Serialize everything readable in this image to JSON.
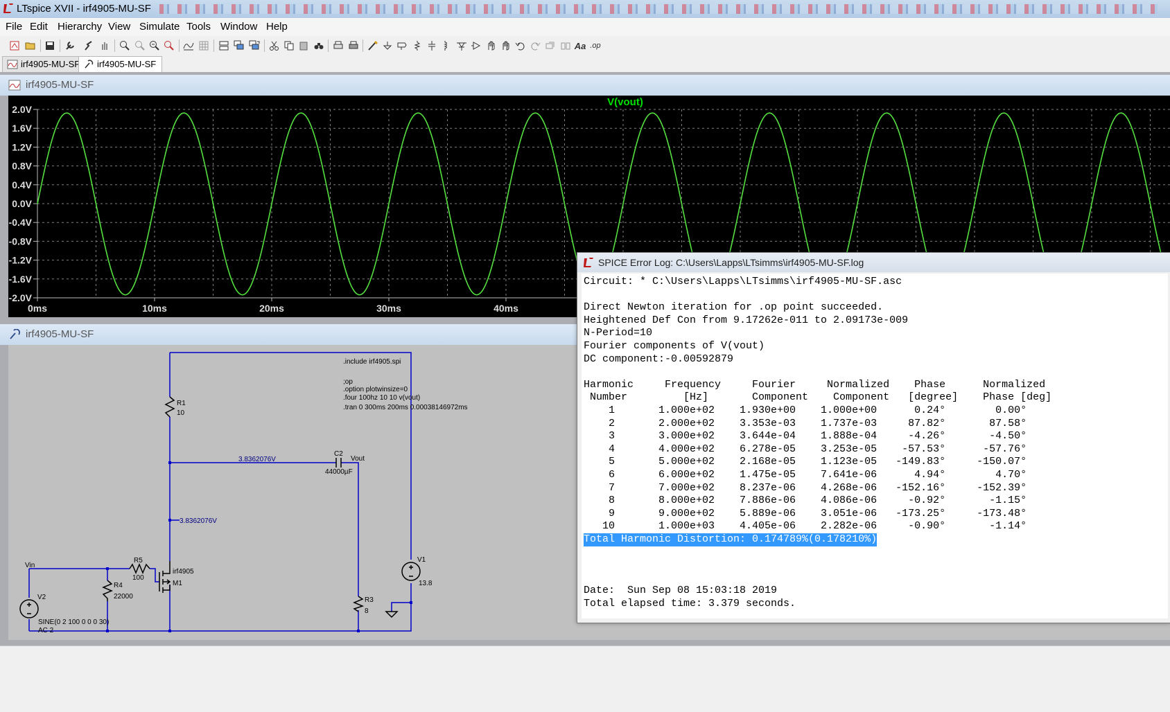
{
  "window": {
    "title": "LTspice XVII - irf4905-MU-SF"
  },
  "menu": [
    "File",
    "Edit",
    "Hierarchy",
    "View",
    "Simulate",
    "Tools",
    "Window",
    "Help"
  ],
  "toolbar": {
    "icons": [
      "new-schematic-icon",
      "open-icon",
      "save-icon",
      "control-panel-icon",
      "run-icon",
      "halt-icon",
      "zoom-in-icon",
      "zoom-pan-icon",
      "zoom-out-icon",
      "zoom-fit-icon",
      "autorange-icon",
      "grid-icon",
      "tile-horizontal-icon",
      "cascade-icon",
      "tile-vertical-icon",
      "cut-icon",
      "copy-icon",
      "paste-icon",
      "find-icon",
      "print-setup-icon",
      "print-icon",
      "wire-icon",
      "ground-icon",
      "label-net-icon",
      "resistor-icon",
      "capacitor-icon",
      "inductor-icon",
      "diode-icon",
      "component-icon",
      "move-icon",
      "drag-icon",
      "undo-icon",
      "redo-icon",
      "rotate-icon",
      "mirror-icon",
      "text-icon",
      "spice-directive-icon"
    ],
    "text_icon_glyph": "Aa",
    "op_icon_glyph": ".op"
  },
  "tabs": [
    {
      "label": "irf4905-MU-SF",
      "icon": "waveform-icon",
      "active": false
    },
    {
      "label": "irf4905-MU-SF",
      "icon": "schematic-icon",
      "active": true
    }
  ],
  "plot_pane": {
    "title": "irf4905-MU-SF",
    "icon": "waveform-icon"
  },
  "schematic_pane": {
    "title": "irf4905-MU-SF",
    "icon": "schematic-icon"
  },
  "chart_data": {
    "type": "line",
    "title": "V(vout)",
    "title_color": "#00e000",
    "trace_color": "#55e040",
    "background": "#000000",
    "grid": true,
    "grid_color": "#7f7f7f",
    "ylim": [
      -2.0,
      2.0
    ],
    "y_ticks": [
      "2.0V",
      "1.6V",
      "1.2V",
      "0.8V",
      "0.4V",
      "0.0V",
      "-0.4V",
      "-0.8V",
      "-1.2V",
      "-1.6V",
      "-2.0V"
    ],
    "x_unit": "ms",
    "x_ticks": [
      "0ms",
      "10ms",
      "20ms",
      "30ms",
      "40ms"
    ],
    "series": [
      {
        "name": "V(vout)",
        "frequency_hz": 100,
        "amplitude_v": 1.93,
        "dc_v": -0.00592879
      }
    ]
  },
  "schematic": {
    "wire_color": "#0000c8",
    "label_color": "#000000",
    "net_label_color": "#000080",
    "directives": [
      ".include irf4905.spi",
      ";op",
      ".option plotwinsize=0",
      ".four 100hz 10 10 v(vout)",
      ".tran 0 300ms 200ms 0.00038146972ms"
    ],
    "components": {
      "R1": {
        "name": "R1",
        "value": "10"
      },
      "R3": {
        "name": "R3",
        "value": "8"
      },
      "R4": {
        "name": "R4",
        "value": "22000"
      },
      "R5": {
        "name": "R5",
        "value": "100"
      },
      "C2": {
        "name": "C2",
        "value": "44000µF"
      },
      "M1": {
        "name": "M1",
        "value": "irf4905"
      },
      "V1": {
        "name": "V1",
        "value": "13.8"
      },
      "V2": {
        "name": "V2",
        "value": "SINE(0 2 100 0 0 0 30)",
        "ac": "AC 2"
      }
    },
    "nets": {
      "vout": "Vout",
      "vin": "Vin",
      "op1": "3.8362076V",
      "op2": "3.8362076V"
    }
  },
  "error_log": {
    "title": "SPICE Error Log: C:\\Users\\Lapps\\LTsimms\\irf4905-MU-SF.log",
    "icon": "ltspice-logo-icon",
    "lines": [
      "Circuit: * C:\\Users\\Lapps\\LTsimms\\irf4905-MU-SF.asc",
      "",
      "Direct Newton iteration for .op point succeeded.",
      "Heightened Def Con from 9.17262e-011 to 2.09173e-009",
      "N-Period=10",
      "Fourier components of V(vout)",
      "DC component:-0.00592879",
      "",
      "Harmonic     Frequency     Fourier     Normalized    Phase      Normalized",
      " Number         [Hz]       Component    Component   [degree]    Phase [deg]",
      "    1       1.000e+02    1.930e+00    1.000e+00      0.24°        0.00°",
      "    2       2.000e+02    3.353e-03    1.737e-03     87.82°       87.58°",
      "    3       3.000e+02    3.644e-04    1.888e-04     -4.26°       -4.50°",
      "    4       4.000e+02    6.278e-05    3.253e-05    -57.53°      -57.76°",
      "    5       5.000e+02    2.168e-05    1.123e-05   -149.83°     -150.07°",
      "    6       6.000e+02    1.475e-05    7.641e-06      4.94°        4.70°",
      "    7       7.000e+02    8.237e-06    4.268e-06   -152.16°     -152.39°",
      "    8       8.000e+02    7.886e-06    4.086e-06     -0.92°       -1.15°",
      "    9       9.000e+02    5.889e-06    3.051e-06   -173.25°     -173.48°",
      "   10       1.000e+03    4.405e-06    2.282e-06     -0.90°       -1.14°",
      "Total Harmonic Distortion: 0.174789%(0.178210%)",
      "",
      "",
      "",
      "Date:  Sun Sep 08 15:03:18 2019",
      "Total elapsed time: 3.379 seconds."
    ],
    "highlight_line": 20,
    "highlight_color": "#3399ff"
  }
}
